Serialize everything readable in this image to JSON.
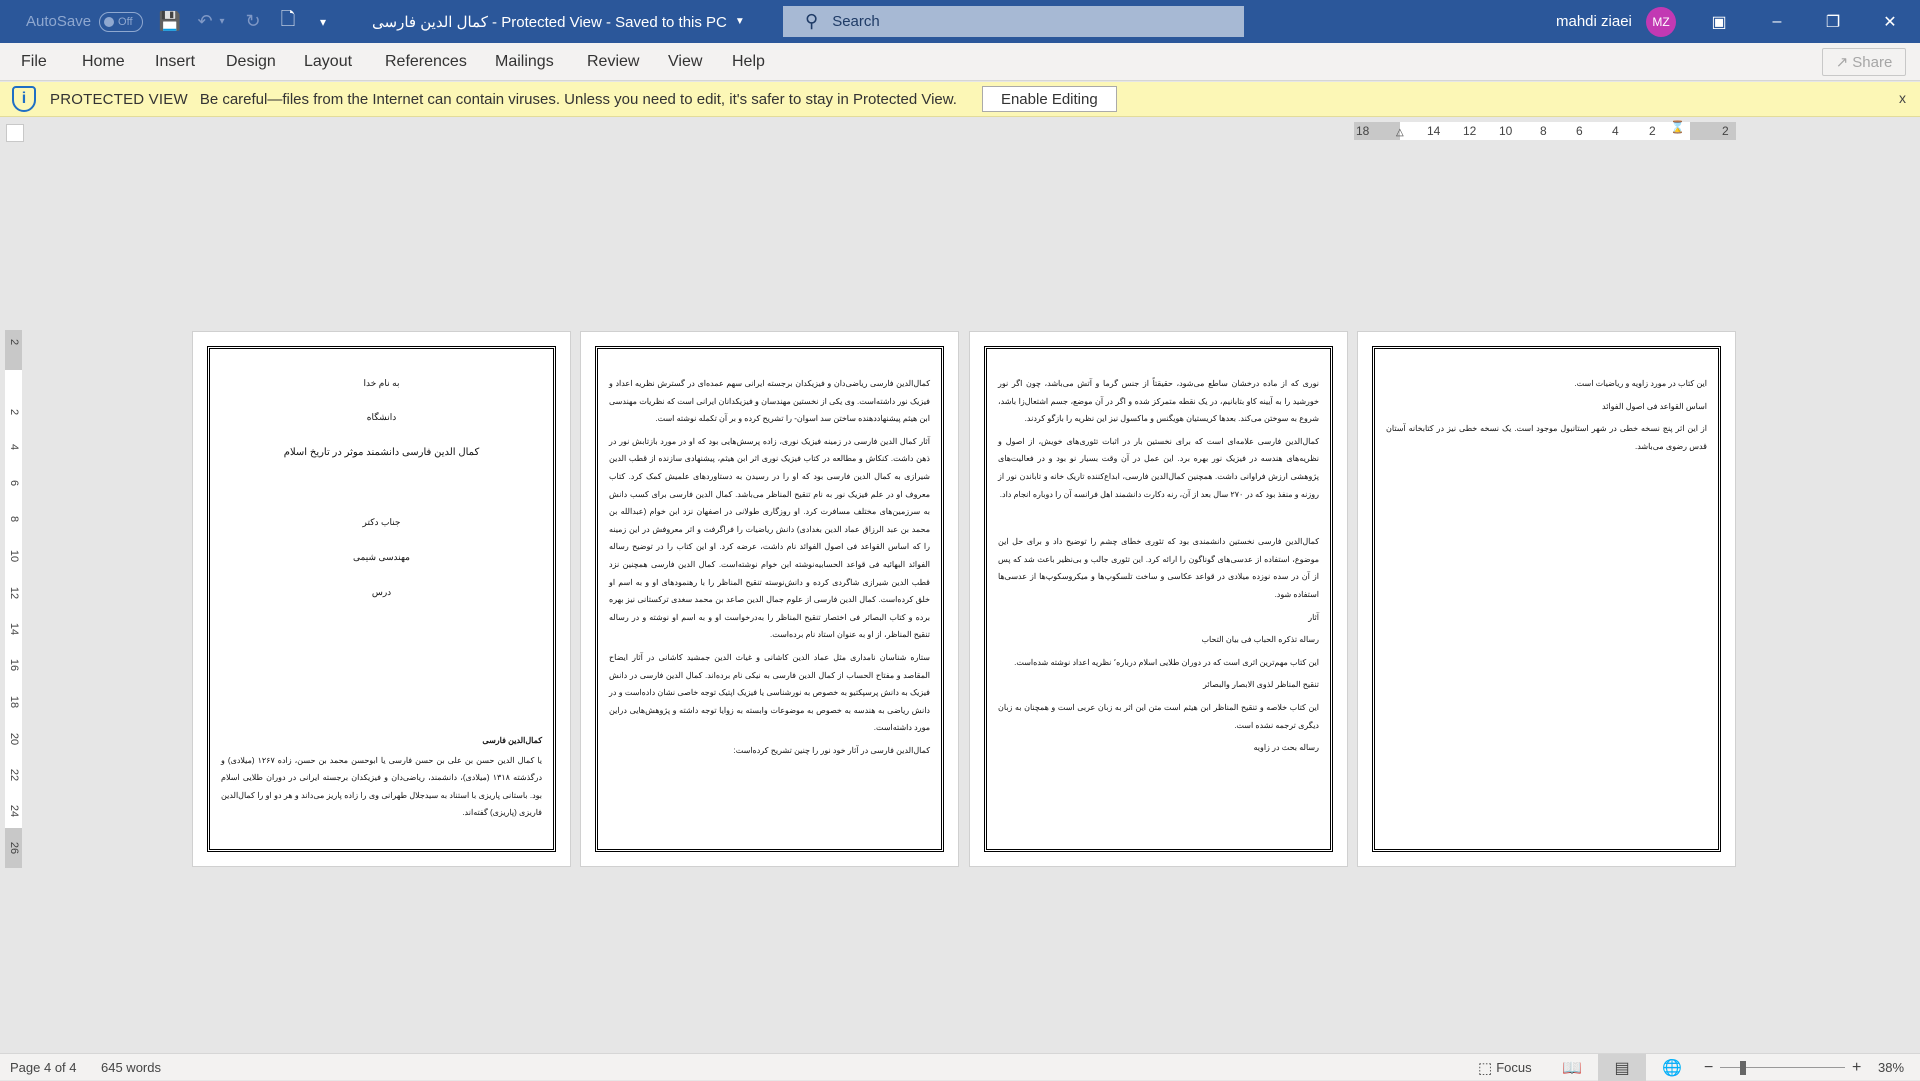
{
  "titlebar": {
    "autosave_label": "AutoSave",
    "autosave_state": "Off",
    "document_title": "کمال الدین فارسی  -  Protected View  -  Saved to this PC",
    "search_placeholder": "Search",
    "user_name": "mahdi ziaei",
    "user_initials": "MZ",
    "avatar_color": "#c239b3",
    "brand_color": "#2b579a"
  },
  "ribbon": {
    "tabs": [
      "File",
      "Home",
      "Insert",
      "Design",
      "Layout",
      "References",
      "Mailings",
      "Review",
      "View",
      "Help"
    ],
    "share_label": "Share"
  },
  "protected_view": {
    "label": "PROTECTED VIEW",
    "message": "Be careful—files from the Internet can contain viruses. Unless you need to edit, it's safer to stay in Protected View.",
    "enable_label": "Enable Editing",
    "close_label": "x"
  },
  "ruler": {
    "horizontal": [
      "18",
      "14",
      "12",
      "10",
      "8",
      "6",
      "4",
      "2",
      "2"
    ],
    "vertical": [
      "2",
      "2",
      "4",
      "6",
      "8",
      "10",
      "12",
      "14",
      "16",
      "18",
      "20",
      "22",
      "24",
      "26"
    ]
  },
  "pages": [
    {
      "title_lines": [
        "به نام خدا",
        "دانشگاه",
        "کمال الدین فارسی دانشمند موثر در تاریخ اسلام",
        "جناب دکتر",
        "مهندسی شیمی",
        "درس"
      ],
      "heading": "کمال‌الدین فارسی",
      "paragraph": "یا کمال الدین حسن بن علی بن حسن فارسی یا ابوحسن محمد بن حسن، زاده ۱۲۶۷ (میلادی) و درگذشته ۱۳۱۸ (میلادی)، دانشمند، ریاضی‌دان و فیزیکدان برجسته ایرانی در دوران طلایی اسلام بود. باستانی پاریزی با استناد به سیدجلال طهرانی وی را زاده پاریز می‌داند و هر دو او را کمال‌الدین فاریزی (پاریزی) گفته‌اند."
    },
    {
      "paragraphs": [
        "کمال‌الدین فارسی ریاضی‌دان و فیزیکدان برجسته ایرانی سهم عمده‌ای در گسترش نظریه اعداد و فیزیک نور داشته‌است. وی یکی از نخستین مهندسان و فیزیکدانان ایرانی است که نظریات مهندسی ابن هیثم پیشنهاددهنده ساختن سد اسوان- را تشریح کرده و بر آن تکمله نوشته است.",
        "آثار کمال الدین فارسی در زمینه فیزیک نوری، زاده پرسش‌هایی بود که او در مورد بازتابش نور در ذهن داشت. کنکاش و مطالعه در کتاب فیزیک نوری اثر ابن هیثم، پیشنهادی سازنده از قطب الدین شیرازی به کمال الدین فارسی بود که او را در رسیدن به دستاوردهای علمیش کمک کرد. کتاب معروف او در علم فیزیک نور به نام تنقیح المناظر می‌باشد. کمال الدین فارسی برای کسب دانش به سرزمین‌های مختلف مسافرت کرد. او روزگاری طولانی در اصفهان نزد ابن خوام (عبدالله بن محمد بن عبد الرزاق عماد الدین بغدادی) دانش ریاضیات را فراگرفت و اثر معروفش در این زمینه را که اساس القواعد فی اصول الفوائد نام داشت، عرضه کرد. او این کتاب را در توضیح رساله الفوائد البهائیه فی قواعد الحسابیه‌نوشته ابن خوام نوشته‌است. کمال الدین فارسی همچنین نزد قطب الدین شیرازی شاگردی کرده و دانش‌نوسته تنقیح المناظر را با رهنمودهای او و به اسم او خلق کرده‌است. کمال الدین فارسی از علوم جمال الدین صاعد بن محمد سغدی ترکستانی نیز بهره برده و کتاب البصائر فی اختصار تنقیح المناظر را به‌درخواست او و به اسم او نوشته و در رساله تنقیح المناظر، از او به عنوان استاد نام برده‌است.",
        "ستاره شناسان نامداری مثل عماد الدین کاشانی و غیاث الدین جمشید کاشانی در آثار ایضاح المقاصد و مفتاح الحساب از کمال الدین فارسی به نیکی نام برده‌اند. کمال الدین فارسی در دانش فیزیک به دانش پرسپکتیو به خصوص به نورشناسی یا فیزیک اپتیک توجه خاصی نشان داده‌است و در دانش ریاضی به هندسه به خصوص به موضوعات وابسته به زوایا توجه داشته و پژوهش‌هایی دراین مورد داشته‌است.",
        "کمال‌الدین فارسی در آثار خود نور را چنین تشریح کرده‌است:"
      ]
    },
    {
      "paragraphs": [
        "نوری که از ماده درخشان ساطع می‌شود، حقیقتاً از جنس گرما و آتش می‌باشد، چون اگر نور خورشید را به آیینه کاو بتابانیم، در یک نقطه متمرکز شده و اگر در آن موضع، جسم اشتعال‌زا باشد، شروع به سوختن می‌کند. بعدها کریستیان هویگنس و ماکسول نیز این نظریه را بازگو کردند.",
        "کمال‌الدین فارسی علامه‌ای است که برای نخستین بار در اثبات تئوری‌های خویش، از اصول و نظریه‌های هندسه در فیزیک نور بهره برد. این عمل در آن وقت بسیار نو بود و در فعالیت‌های پژوهشی ارزش فراوانی داشت. همچنین کمال‌الدین فارسی، ابداع‌کننده تاریک خانه و تاباندن نور از روزنه و منفذ بود که در ۲۷۰ سال بعد از آن، رنه دکارت دانشمند اهل فرانسه آن را دوباره انجام داد.",
        "",
        "کمال‌الدین فارسی نخستین دانشمندی بود که تئوری خطای چشم را توضیح داد و برای حل این موضوع، استفاده از عدسی‌های گوناگون را ارائه کرد. این تئوری جالب و بی‌نظیر باعث شد که پس از آن در سده نوزده میلادی در قواعد عکاسی و ساخت تلسکوپ‌ها و میکروسکوپ‌ها از عدسی‌ها استفاده شود.",
        "آثار",
        "رساله تذکره الحباب فی بیان التحاب",
        "این کتاب مهم‌ترین اثری است که در دوران طلایی اسلام درباره٬ نظریه اعداد نوشته شده‌است.",
        "تنقیح المناظر لذوی الابصار والبصائر",
        "این کتاب خلاصه و تنقیح المناظر ابن هیثم است متن این اثر به زبان عربی است و همچنان به زبان دیگری ترجمه نشده است.",
        "رساله بحث در زاویه"
      ]
    },
    {
      "paragraphs": [
        "این کتاب در مورد زاویه و ریاضیات است.",
        "اساس القواعد فی اصول الفوائد",
        "از این اثر پنج نسخه خطی در شهر استانبول موجود است. یک نسخه خطی نیز در کتابخانه آستان قدس رضوی می‌باشد."
      ]
    }
  ],
  "status": {
    "page": "Page 4 of 4",
    "words": "645 words",
    "focus_label": "Focus",
    "zoom_level": "38%",
    "zoom_minus": "−",
    "zoom_plus": "+"
  }
}
